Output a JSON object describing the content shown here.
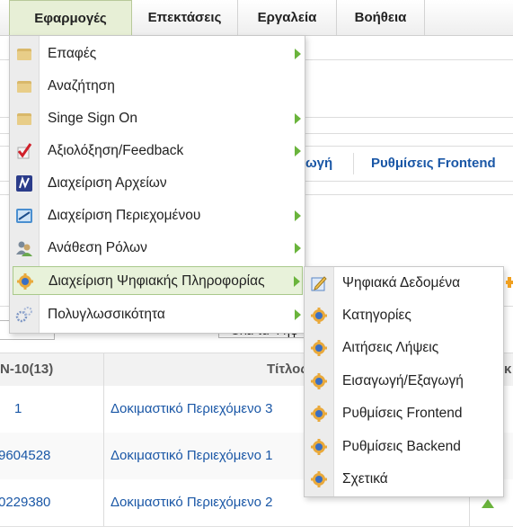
{
  "menubar": {
    "items": [
      {
        "label": "Εφαρμογές"
      },
      {
        "label": "Επεκτάσεις"
      },
      {
        "label": "Εργαλεία"
      },
      {
        "label": "Βοήθεια"
      }
    ]
  },
  "background": {
    "tab_partial": "ωγή",
    "tab_frontend": "Ρυθμίσεις Frontend",
    "filter_select_value": "- Όλα τα Ψηφ",
    "table": {
      "header_id": "N-10(13)",
      "header_title": "Τίτλος",
      "header_right": "κ",
      "rows": [
        {
          "id": "1",
          "title": "Δοκιμαστικό Περιεχόμενο 3"
        },
        {
          "id": "9604528",
          "title": "Δοκιμαστικό Περιεχόμενο 1"
        },
        {
          "id": "0229380",
          "title": "Δοκιμαστικό Περιεχόμενο 2"
        }
      ]
    }
  },
  "apps_menu": {
    "items": [
      {
        "label": "Επαφές",
        "icon": "folder-icon",
        "has_submenu": true
      },
      {
        "label": "Αναζήτηση",
        "icon": "folder-icon",
        "has_submenu": false
      },
      {
        "label": "Singe Sign On",
        "icon": "folder-icon",
        "has_submenu": true
      },
      {
        "label": "Αξιολόξηση/Feedback",
        "icon": "checkmark-icon",
        "has_submenu": true
      },
      {
        "label": "Διαχείριση Αρχείων",
        "icon": "file-manager-icon",
        "has_submenu": false
      },
      {
        "label": "Διαχείριση Περιεχομένου",
        "icon": "content-icon",
        "has_submenu": true
      },
      {
        "label": "Ανάθεση Ρόλων",
        "icon": "users-icon",
        "has_submenu": true
      },
      {
        "label": "Διαχείριση Ψηφιακής Πληροφορίας",
        "icon": "digital-info-icon",
        "has_submenu": true,
        "highlighted": true
      },
      {
        "label": "Πολυγλωσσικότητα",
        "icon": "gears-icon",
        "has_submenu": true
      }
    ]
  },
  "submenu": {
    "items": [
      {
        "label": "Ψηφιακά Δεδομένα",
        "icon": "edit-data-icon"
      },
      {
        "label": "Κατηγορίες",
        "icon": "digital-info-icon"
      },
      {
        "label": "Αιτήσεις Λήψεις",
        "icon": "digital-info-icon"
      },
      {
        "label": "Εισαγωγή/Εξαγωγή",
        "icon": "digital-info-icon"
      },
      {
        "label": "Ρυθμίσεις Frontend",
        "icon": "digital-info-icon"
      },
      {
        "label": "Ρυθμίσεις Backend",
        "icon": "digital-info-icon"
      },
      {
        "label": "Σχετικά",
        "icon": "digital-info-icon"
      }
    ]
  },
  "colors": {
    "link": "#1a57a6",
    "arrow": "#6ab43c",
    "highlight_bg": "#e8f2da",
    "highlight_border": "#a9c98b",
    "active_menubar_bg": "#e7efd6"
  }
}
